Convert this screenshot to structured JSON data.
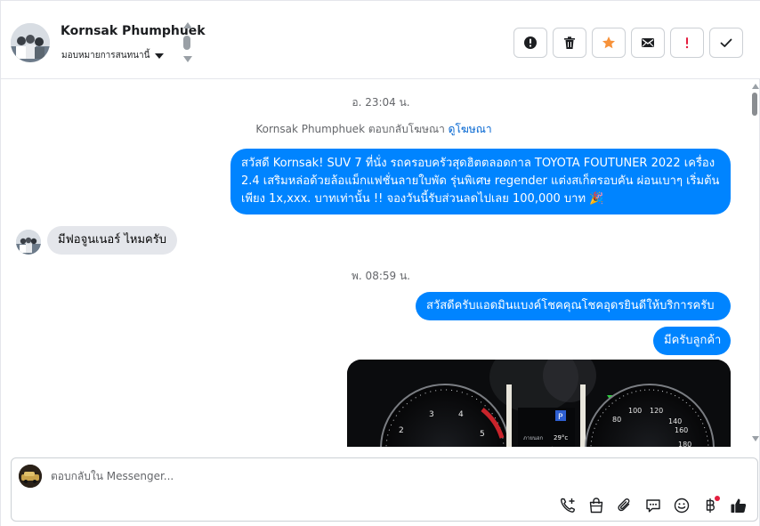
{
  "header": {
    "contact_name": "Kornsak Phumphuek",
    "assign_label": "มอบหมายการสนทนานี้"
  },
  "messages": {
    "timestamp_1": "อ. 23:04 น.",
    "ad_reply_prefix": "Kornsak Phumphuek ตอบกลับโฆษณา",
    "ad_link": "ดูโฆษณา",
    "out_1": "สวัสดี Kornsak! SUV 7 ที่นั่ง รถครอบครัวสุดฮิตตลอดกาล TOYOTA FOUTUNER 2022 เครื่อง 2.4 เสริมหล่อด้วยล้อแม็กแฟชั่นลายใบพัด รุ่นพิเศษ regender แต่งสเก็ตรอบคัน ผ่อนเบาๆ เริ่มต้นเพียง 1x,xxx. บาทเท่านั้น !! จองวันนี้รับส่วนลดไปเลย 100,000 บาท 🎉",
    "in_1": "มีฟอจูนเนอร์ ไหมครับ",
    "timestamp_2": "พ. 08:59 น.",
    "out_2": "สวัสดีครับแอดมินแบงค์โชคคุณโชคอุดรยินดีให้บริการครับ",
    "out_3": "มีครับลูกค้า"
  },
  "composer": {
    "placeholder": "ตอบกลับใน Messenger..."
  },
  "colors": {
    "outgoing_bubble": "#0084ff",
    "incoming_bubble": "#e4e6eb",
    "star": "#f7923a",
    "alert": "#e41e3f"
  },
  "icons": {
    "header_actions": [
      "info-icon",
      "trash-icon",
      "star-icon",
      "mail-icon",
      "exclamation-icon",
      "check-icon"
    ],
    "composer_tools": [
      "phone-plus-icon",
      "shopping-bag-icon",
      "paperclip-icon",
      "chat-dots-icon",
      "smile-icon",
      "baht-icon",
      "thumbs-up-icon"
    ]
  }
}
